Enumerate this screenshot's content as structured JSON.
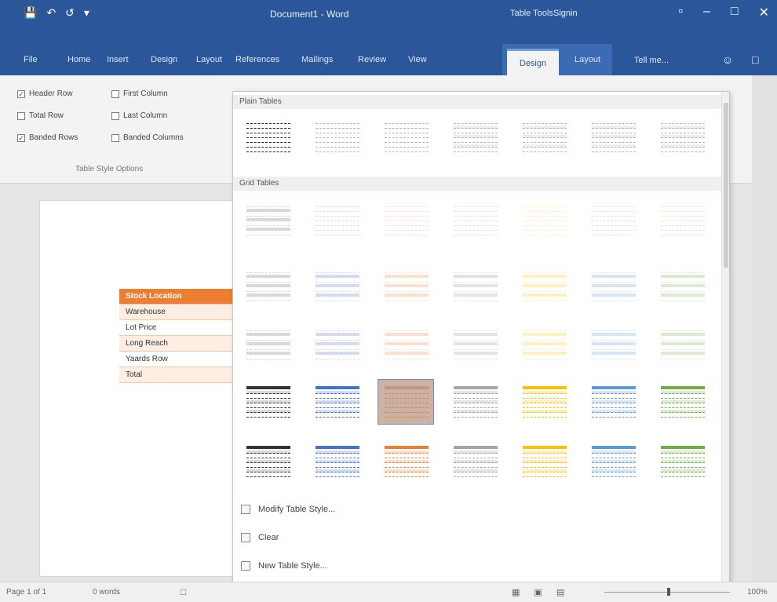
{
  "title_bar": {
    "doc_title": "Document1 - Word",
    "context_group": "Table Tools",
    "user": "Signin",
    "qat": [
      "save-icon",
      "undo-icon",
      "redo-icon",
      "customize-icon"
    ],
    "window_buttons": [
      "ribbon-display-icon",
      "minimize-icon",
      "maximize-icon",
      "close-icon"
    ]
  },
  "tabs": [
    "File",
    "Home",
    "Insert",
    "Design",
    "Layout",
    "References",
    "Mailings",
    "Review",
    "View"
  ],
  "context_tabs": [
    "Design",
    "Layout"
  ],
  "tell_me": "Tell me...",
  "style_options": {
    "checkboxes": [
      {
        "label": "Header Row",
        "checked": true
      },
      {
        "label": "First Column",
        "checked": false
      },
      {
        "label": "Total Row",
        "checked": false
      },
      {
        "label": "Last Column",
        "checked": false
      },
      {
        "label": "Banded Rows",
        "checked": true
      },
      {
        "label": "Banded Columns",
        "checked": false
      }
    ],
    "group_label": "Table Style Options"
  },
  "gallery": {
    "sections": [
      "Plain Tables",
      "Grid Tables"
    ],
    "commands": [
      "Modify Table Style...",
      "Clear",
      "New Table Style..."
    ]
  },
  "page_table": {
    "rows": [
      "Stock Location",
      "Warehouse",
      "Lot Price",
      "Long Reach",
      "Yaards Row",
      "Total"
    ]
  },
  "colors": {
    "title_bar": "#2b579a",
    "accent_orange": "#ed7d31",
    "ribbon_bg": "#f3f3f3"
  },
  "status_bar": {
    "page": "Page 1 of 1",
    "words": "0 words",
    "zoom": "100%"
  }
}
